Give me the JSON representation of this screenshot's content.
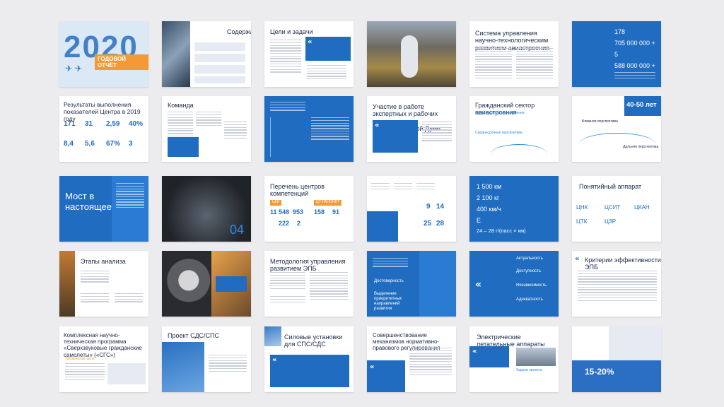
{
  "colors": {
    "brand_blue": "#1f6cc0",
    "accent_blue": "#2b8ae6",
    "orange": "#f39a36",
    "bg": "#ececef"
  },
  "slides": {
    "s01": {
      "year": "2020",
      "badge": "ГОДОВОЙ ОТЧЁТ"
    },
    "s02": {
      "title": "Содержание"
    },
    "s03": {
      "title": "Цели и задачи"
    },
    "s05": {
      "title": "Система управления научно-технологическим развитием авиастроения"
    },
    "s06": {
      "n1": "178",
      "n2": "705 000 000 +",
      "n3": "5",
      "n4": "588 000 000 +"
    },
    "s07": {
      "title": "Результаты выполнения показателей Центра в 2019 году",
      "k1": "171",
      "k2": "31",
      "k3": "2,59",
      "k4": "40%",
      "k5": "8,4",
      "k6": "5,6",
      "k7": "67%",
      "k8": "3"
    },
    "s08": {
      "title": "Команда"
    },
    "s10": {
      "title": "Участие в работе экспертных и рабочих групп при Государственной Думе"
    },
    "s11": {
      "title": "Гражданский сектор авиастроения",
      "sub1": "Магистральная авиастроения",
      "sub2": "Среднесрочная перспектива"
    },
    "s12": {
      "big": "40-50 лет",
      "sub1": "Ближняя перспектива",
      "sub2": "Дальняя перспектива"
    },
    "s13": {
      "title": "Мост в настоящее"
    },
    "s14": {
      "num": "04"
    },
    "s15": {
      "title": "Перечень центров компетенций",
      "tag1": "ЦКИ",
      "tag2": "ЦТ-НАНОНЕТ",
      "v1": "11 548",
      "v2": "953",
      "v3": "222",
      "v4": "2",
      "v5": "158",
      "v6": "91"
    },
    "s16": {
      "a": "9",
      "b": "14",
      "c": "25",
      "d": "28"
    },
    "s17": {
      "l1": "1 500 км",
      "l2": "2 100 кг",
      "l3": "400 км/ч",
      "l4": "Е",
      "l5": "24 – 28 г/(пасс × км)"
    },
    "s18": {
      "title": "Понятийный аппарат",
      "c1": "ЦНК",
      "c2": "ЦСИТ",
      "c3": "ЦКАН",
      "c4": "ЦТК",
      "c5": "ЦЗР"
    },
    "s19": {
      "title": "Этапы анализа"
    },
    "s21": {
      "title": "Методология управления развитием ЭПБ"
    },
    "s22": {
      "t1": "Достоверность",
      "t2": "Выделение приоритетных направлений развития"
    },
    "s23": {
      "t1": "Актуальность",
      "t2": "Доступность",
      "t3": "Независимость",
      "t4": "Адекватность"
    },
    "s24": {
      "title": "Критерии эффективности ЭПБ"
    },
    "s25": {
      "title": "Комплексная научно-техническая программа «Сверхзвуковые гражданские самолеты» («СГС»)",
      "sub": "Технические цели"
    },
    "s26": {
      "title": "Проект СДС/СПС"
    },
    "s27": {
      "title": "Силовые установки для СПС/СДС"
    },
    "s28": {
      "title": "Совершенствование механизмов нормативно-правового регулирования"
    },
    "s29": {
      "title": "Электрические летательные аппараты",
      "sub": "Задачи проекта"
    },
    "s30": {
      "big": "15-20%"
    }
  }
}
